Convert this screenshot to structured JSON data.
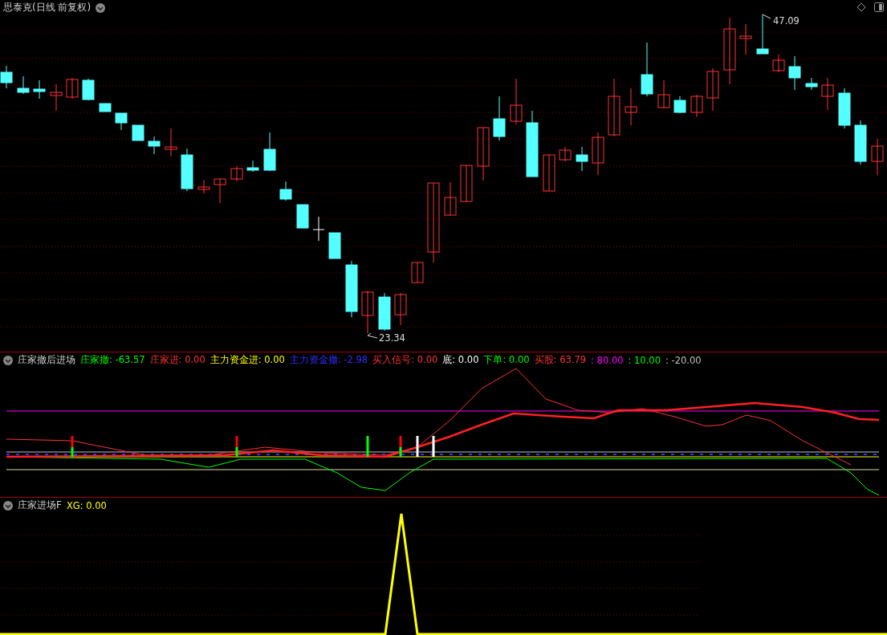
{
  "main_chart": {
    "title": "思泰克(日线 前复权)",
    "high_label": "47.09",
    "low_label": "23.34"
  },
  "indicator_panel": {
    "name": "庄家撤后进场",
    "items": [
      {
        "text": "庄家撤: -63.57",
        "color": "#00ff00"
      },
      {
        "text": "庄家进: 0.00",
        "color": "#ff3232"
      },
      {
        "text": "主力资金进: 0.00",
        "color": "#ffff00"
      },
      {
        "text": "主力资金撤: -2.98",
        "color": "#3030ff"
      },
      {
        "text": "买入信号: 0.00",
        "color": "#ff3232"
      },
      {
        "text": "底: 0.00",
        "color": "#ffffff"
      },
      {
        "text": "下单: 0.00",
        "color": "#00ff00"
      },
      {
        "text": "买股: 63.79",
        "color": "#ff3232"
      },
      {
        "text": ": 80.00",
        "color": "#ff00ff"
      },
      {
        "text": ": 10.00",
        "color": "#00ff00"
      },
      {
        "text": ": -20.00",
        "color": "#c0c0c0"
      }
    ]
  },
  "signal_panel": {
    "name": "庄家进场F",
    "items": [
      {
        "text": "XG: 0.00",
        "color": "#ffff00"
      }
    ]
  }
}
